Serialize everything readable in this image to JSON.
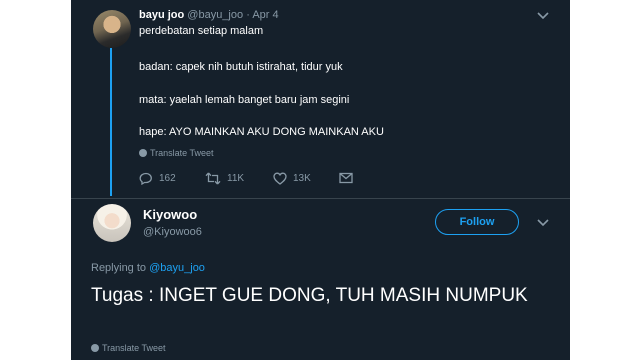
{
  "tweet1": {
    "author_name": "bayu joo",
    "author_handle": "@bayu_joo",
    "separator": "·",
    "date": "Apr 4",
    "lines": [
      "perdebatan setiap malam",
      "badan: capek nih butuh istirahat, tidur yuk",
      "mata: yaelah lemah banget baru jam segini",
      "hape: AYO MAINKAN AKU DONG MAINKAN AKU"
    ],
    "translate_label": "Translate Tweet",
    "stats": {
      "replies": "162",
      "retweets": "11K",
      "likes": "13K"
    },
    "icons": [
      "reply-icon",
      "retweet-icon",
      "like-icon",
      "dm-icon",
      "chevron-down-icon",
      "globe-icon"
    ]
  },
  "tweet2": {
    "author_name": "Kiyowoo",
    "author_handle": "@Kiyowoo6",
    "follow_label": "Follow",
    "replying_prefix": "Replying to",
    "replying_mention": "@bayu_joo",
    "text": "Tugas : INGET GUE DONG, TUH MASIH NUMPUK",
    "translate_label": "Translate Tweet"
  },
  "colors": {
    "background": "#15202b",
    "text": "#ffffff",
    "secondary": "#8899a6",
    "accent": "#1da1f2",
    "divider": "#38444d"
  }
}
